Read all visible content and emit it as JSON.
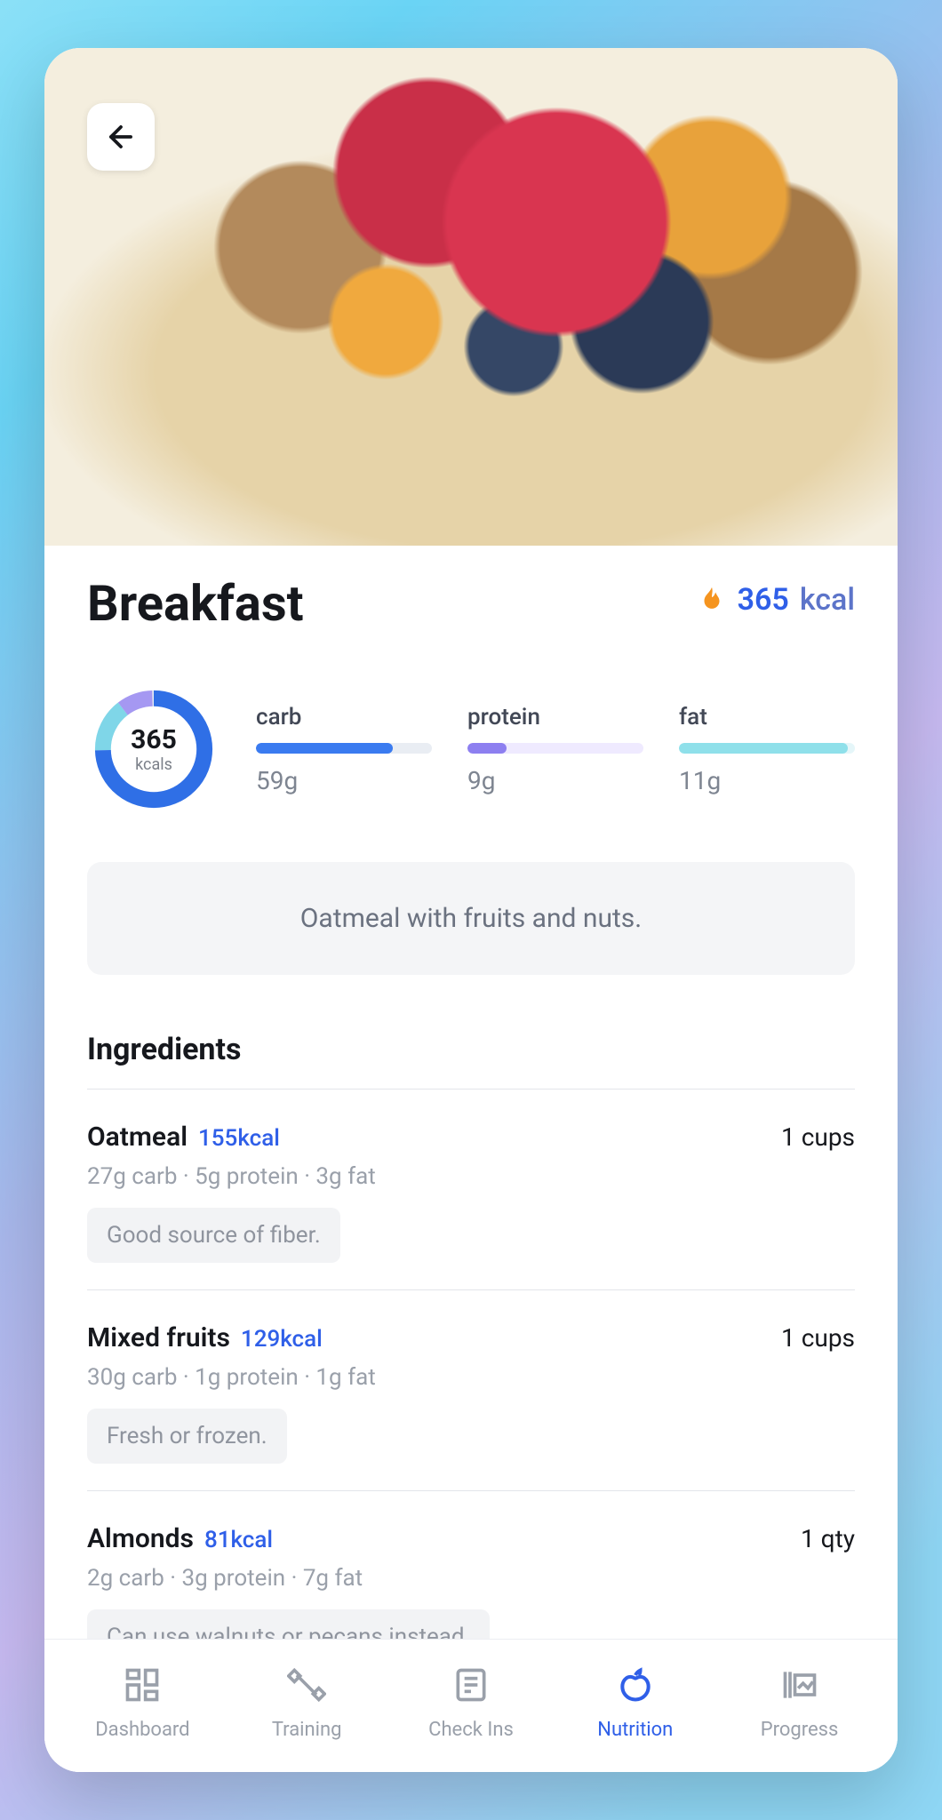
{
  "meal": {
    "title": "Breakfast",
    "calories": "365",
    "calories_unit": "kcal",
    "donut": {
      "value": "365",
      "unit": "kcals",
      "carb_pct": 75,
      "protein_pct": 10,
      "fat_pct": 15
    },
    "macros": {
      "carb": {
        "label": "carb",
        "value": "59g",
        "fill_pct": 78,
        "color": "#3a7bf0",
        "track": "#e9edf3"
      },
      "protein": {
        "label": "protein",
        "value": "9g",
        "fill_pct": 22,
        "color": "#8d7ff0",
        "track": "#efeaff"
      },
      "fat": {
        "label": "fat",
        "value": "11g",
        "fill_pct": 96,
        "color": "#8fe0ea",
        "track": "#e5f6f9"
      }
    },
    "description": "Oatmeal with fruits and nuts."
  },
  "ingredients_heading": "Ingredients",
  "ingredients": [
    {
      "name": "Oatmeal",
      "calories": "155kcal",
      "qty": "1 cups",
      "macros": "27g carb  ·  5g protein  ·  3g fat",
      "note": "Good source of fiber."
    },
    {
      "name": "Mixed fruits",
      "calories": "129kcal",
      "qty": "1 cups",
      "macros": "30g carb  ·  1g protein  ·  1g fat",
      "note": "Fresh or frozen."
    },
    {
      "name": "Almonds",
      "calories": "81kcal",
      "qty": "1 qty",
      "macros": "2g carb  ·  3g protein  ·  7g fat",
      "note": "Can use walnuts or pecans instead."
    }
  ],
  "tabs": [
    {
      "id": "dashboard",
      "label": "Dashboard",
      "active": false
    },
    {
      "id": "training",
      "label": "Training",
      "active": false
    },
    {
      "id": "checkins",
      "label": "Check Ins",
      "active": false
    },
    {
      "id": "nutrition",
      "label": "Nutrition",
      "active": true
    },
    {
      "id": "progress",
      "label": "Progress",
      "active": false
    }
  ]
}
